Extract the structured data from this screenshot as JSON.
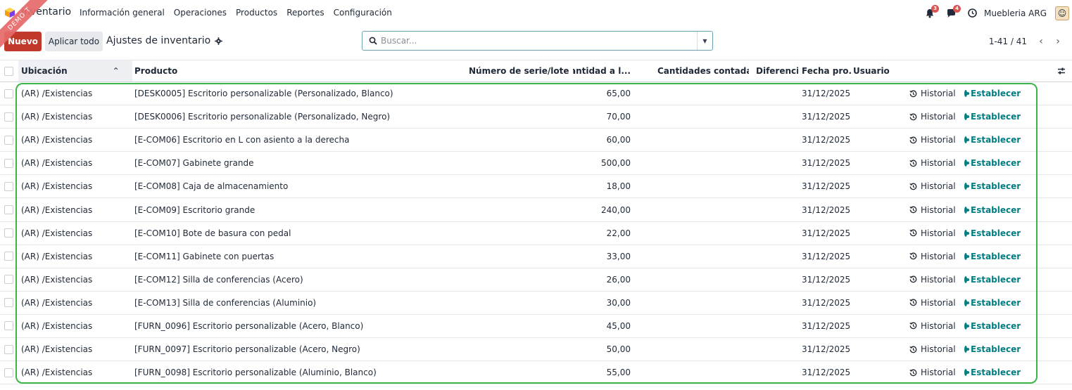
{
  "navbar": {
    "app_name": "Inventario",
    "menu": [
      "Información general",
      "Operaciones",
      "Productos",
      "Reportes",
      "Configuración"
    ],
    "activity_count": "3",
    "messages_count": "4",
    "company": "Muebleria ARG"
  },
  "ribbon": "DEMO T",
  "control": {
    "new_label": "Nuevo",
    "apply_label": "Aplicar todo",
    "title": "Ajustes de inventario",
    "search_placeholder": "Buscar...",
    "pager": "1-41 / 41"
  },
  "table": {
    "headers": {
      "ubicacion": "Ubicación",
      "producto": "Producto",
      "serie": "Número de serie/lote",
      "cantidad": "Cantidad a l...",
      "contadas": "Cantidades contadas",
      "diferencia": "Diferencia",
      "fecha": "Fecha pro...",
      "usuario": "Usuario"
    },
    "historial_label": "Historial",
    "establecer_label": "Establecer",
    "rows": [
      {
        "ubicacion": "(AR) /Existencias",
        "producto": "[DESK0005] Escritorio personalizable (Personalizado, Blanco)",
        "cantidad": "65,00",
        "fecha": "31/12/2025"
      },
      {
        "ubicacion": "(AR) /Existencias",
        "producto": "[DESK0006] Escritorio personalizable (Personalizado, Negro)",
        "cantidad": "70,00",
        "fecha": "31/12/2025"
      },
      {
        "ubicacion": "(AR) /Existencias",
        "producto": "[E-COM06] Escritorio en L con asiento a la derecha",
        "cantidad": "60,00",
        "fecha": "31/12/2025"
      },
      {
        "ubicacion": "(AR) /Existencias",
        "producto": "[E-COM07] Gabinete grande",
        "cantidad": "500,00",
        "fecha": "31/12/2025"
      },
      {
        "ubicacion": "(AR) /Existencias",
        "producto": "[E-COM08] Caja de almacenamiento",
        "cantidad": "18,00",
        "fecha": "31/12/2025"
      },
      {
        "ubicacion": "(AR) /Existencias",
        "producto": "[E-COM09] Escritorio grande",
        "cantidad": "240,00",
        "fecha": "31/12/2025"
      },
      {
        "ubicacion": "(AR) /Existencias",
        "producto": "[E-COM10] Bote de basura con pedal",
        "cantidad": "22,00",
        "fecha": "31/12/2025"
      },
      {
        "ubicacion": "(AR) /Existencias",
        "producto": "[E-COM11] Gabinete con puertas",
        "cantidad": "33,00",
        "fecha": "31/12/2025"
      },
      {
        "ubicacion": "(AR) /Existencias",
        "producto": "[E-COM12] Silla de conferencias (Acero)",
        "cantidad": "26,00",
        "fecha": "31/12/2025"
      },
      {
        "ubicacion": "(AR) /Existencias",
        "producto": "[E-COM13] Silla de conferencias (Aluminio)",
        "cantidad": "30,00",
        "fecha": "31/12/2025"
      },
      {
        "ubicacion": "(AR) /Existencias",
        "producto": "[FURN_0096] Escritorio personalizable (Acero, Blanco)",
        "cantidad": "45,00",
        "fecha": "31/12/2025"
      },
      {
        "ubicacion": "(AR) /Existencias",
        "producto": "[FURN_0097] Escritorio personalizable (Acero, Negro)",
        "cantidad": "50,00",
        "fecha": "31/12/2025"
      },
      {
        "ubicacion": "(AR) /Existencias",
        "producto": "[FURN_0098] Escritorio personalizable (Aluminio, Blanco)",
        "cantidad": "55,00",
        "fecha": "31/12/2025"
      }
    ]
  },
  "colors": {
    "primary": "#c0392b",
    "accent": "#017e84",
    "highlight_frame": "#3cb54a"
  }
}
